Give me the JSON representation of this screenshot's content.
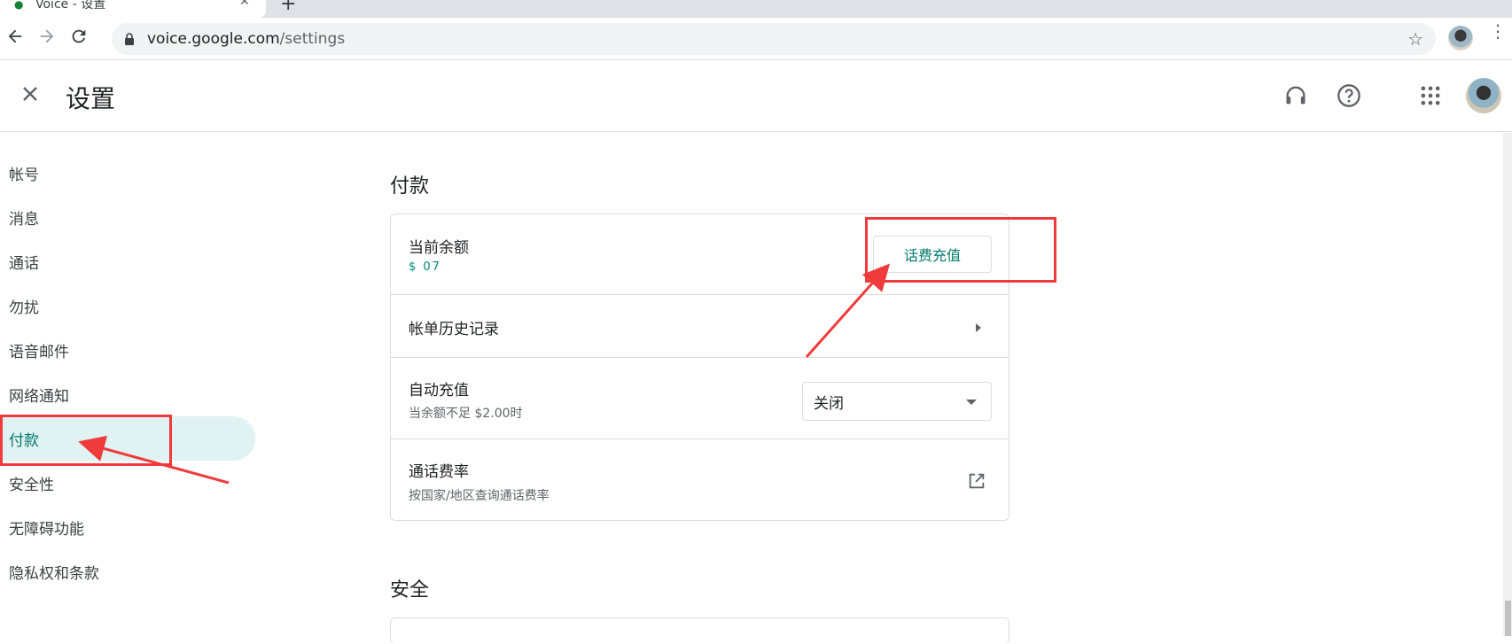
{
  "browser": {
    "tab_title": "Voice - 设置",
    "url_host": "voice.google.com",
    "url_path": "/settings"
  },
  "header": {
    "title": "设置"
  },
  "sidebar": {
    "items": [
      {
        "label": "帐号"
      },
      {
        "label": "消息"
      },
      {
        "label": "通话"
      },
      {
        "label": "勿扰"
      },
      {
        "label": "语音邮件"
      },
      {
        "label": "网络通知"
      },
      {
        "label": "付款"
      },
      {
        "label": "安全性"
      },
      {
        "label": "无障碍功能"
      },
      {
        "label": "隐私权和条款"
      }
    ],
    "active_index": 6
  },
  "payment": {
    "section_title": "付款",
    "balance_label": "当前余额",
    "balance_value": "$ 07",
    "topup_button": "话费充值",
    "billing_history_label": "帐单历史记录",
    "auto_topup_label": "自动充值",
    "auto_topup_sub": "当余额不足 $2.00时",
    "auto_topup_value": "关闭",
    "rates_label": "通话费率",
    "rates_sub": "按国家/地区查询通话费率"
  },
  "security": {
    "section_title": "安全"
  },
  "colors": {
    "accent": "#00796b",
    "active_bg": "#e0f2f1",
    "annotation": "#ef3b3b"
  }
}
